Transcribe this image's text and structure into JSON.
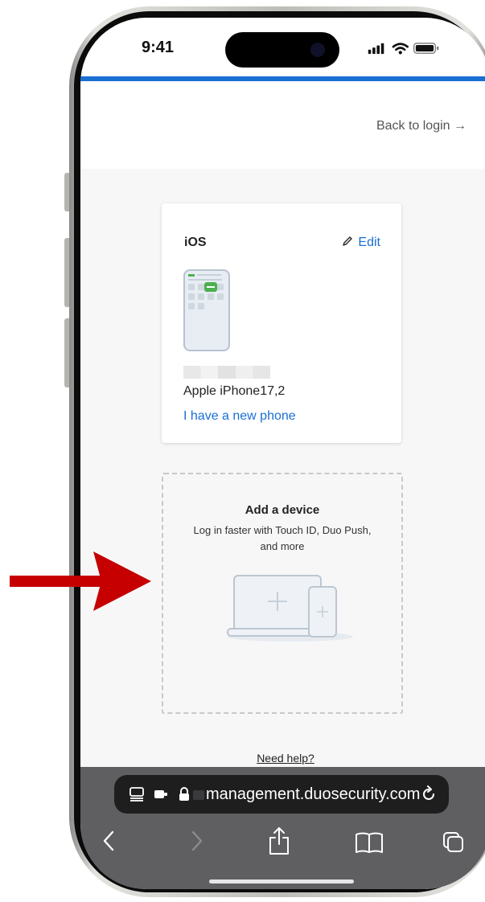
{
  "status_bar": {
    "time": "9:41"
  },
  "header": {
    "back_link": "Back to login →"
  },
  "device_card": {
    "os_label": "iOS",
    "edit_label": "Edit",
    "device_model": "Apple iPhone17,2",
    "new_phone_link": "I have a new phone"
  },
  "add_device": {
    "title": "Add a device",
    "subtitle": "Log in faster with Touch ID, Duo Push, and more"
  },
  "help_link": "Need help?",
  "browser": {
    "url": "management.duosecurity.com"
  },
  "colors": {
    "accent": "#1a6fd3",
    "arrow": "#c60000",
    "badge": "#4caf50"
  }
}
